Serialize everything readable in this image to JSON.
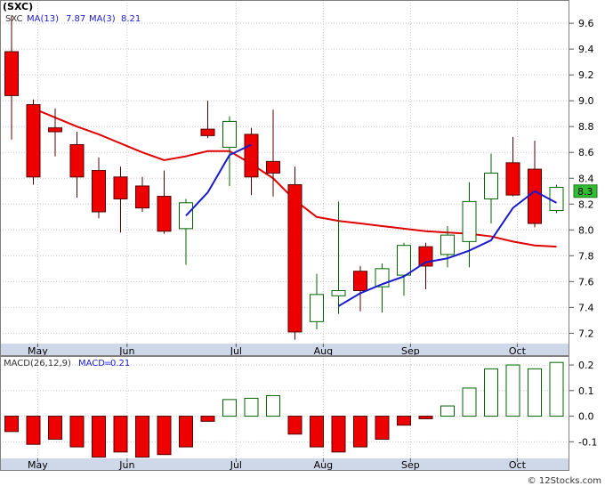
{
  "ticker": "(SXC)",
  "colors": {
    "background": "#ffffff",
    "frame": "#808080",
    "grid": "#c8c8c8",
    "axis_band": "#cfd8e8",
    "up_fill": "#ffffff",
    "up_stroke": "#006400",
    "down_fill": "#ee0000",
    "down_stroke": "#550000",
    "ma13": "#e00000",
    "ma3": "#1a1acc",
    "macd_pos_stroke": "#006400",
    "macd_neg_fill": "#ee0000",
    "last_price_box": "#33bb33"
  },
  "chart_data": [
    {
      "type": "candlestick",
      "symbol": "SXC",
      "legend": {
        "symbol_label": "SXC",
        "ma13_label": "MA(13)",
        "ma13_value": "7.87",
        "ma3_label": "MA(3)",
        "ma3_value": "8.21"
      },
      "ylim": [
        7.12,
        9.78
      ],
      "yticks": [
        7.2,
        7.4,
        7.6,
        7.8,
        8.0,
        8.2,
        8.4,
        8.6,
        8.8,
        9.0,
        9.2,
        9.4,
        9.6
      ],
      "ytick_labels": [
        "7.2",
        "7.4",
        "7.6",
        "7.8",
        "8.0",
        "8.2",
        "8.4",
        "8.6",
        "8.8",
        "9.0",
        "9.2",
        "9.4",
        "9.6"
      ],
      "x_month_labels": [
        {
          "label": "May",
          "index": 1.2
        },
        {
          "label": "Jun",
          "index": 5.3
        },
        {
          "label": "Jul",
          "index": 10.3
        },
        {
          "label": "Aug",
          "index": 14.3
        },
        {
          "label": "Sep",
          "index": 18.3
        },
        {
          "label": "Oct",
          "index": 23.2
        }
      ],
      "last_price_label": "8.3",
      "last_price": 8.3,
      "candles": [
        {
          "o": 9.38,
          "h": 9.66,
          "l": 8.7,
          "c": 9.04
        },
        {
          "o": 8.97,
          "h": 9.01,
          "l": 8.35,
          "c": 8.41
        },
        {
          "o": 8.79,
          "h": 8.94,
          "l": 8.57,
          "c": 8.76
        },
        {
          "o": 8.66,
          "h": 8.76,
          "l": 8.25,
          "c": 8.41
        },
        {
          "o": 8.46,
          "h": 8.56,
          "l": 8.09,
          "c": 8.14
        },
        {
          "o": 8.41,
          "h": 8.49,
          "l": 7.98,
          "c": 8.24
        },
        {
          "o": 8.34,
          "h": 8.41,
          "l": 8.14,
          "c": 8.17
        },
        {
          "o": 8.26,
          "h": 8.46,
          "l": 7.97,
          "c": 7.99
        },
        {
          "o": 8.01,
          "h": 8.24,
          "l": 7.73,
          "c": 8.21
        },
        {
          "o": 8.78,
          "h": 9.0,
          "l": 8.71,
          "c": 8.73
        },
        {
          "o": 8.64,
          "h": 8.88,
          "l": 8.34,
          "c": 8.84
        },
        {
          "o": 8.74,
          "h": 8.79,
          "l": 8.27,
          "c": 8.41
        },
        {
          "o": 8.53,
          "h": 8.93,
          "l": 8.26,
          "c": 8.44
        },
        {
          "o": 8.35,
          "h": 8.49,
          "l": 7.15,
          "c": 7.21
        },
        {
          "o": 7.29,
          "h": 7.66,
          "l": 7.23,
          "c": 7.5
        },
        {
          "o": 7.49,
          "h": 8.22,
          "l": 7.35,
          "c": 7.53
        },
        {
          "o": 7.68,
          "h": 7.72,
          "l": 7.37,
          "c": 7.53
        },
        {
          "o": 7.56,
          "h": 7.74,
          "l": 7.36,
          "c": 7.7
        },
        {
          "o": 7.65,
          "h": 7.9,
          "l": 7.49,
          "c": 7.88
        },
        {
          "o": 7.87,
          "h": 7.9,
          "l": 7.54,
          "c": 7.72
        },
        {
          "o": 7.81,
          "h": 8.03,
          "l": 7.71,
          "c": 7.96
        },
        {
          "o": 7.91,
          "h": 8.37,
          "l": 7.71,
          "c": 8.22
        },
        {
          "o": 8.24,
          "h": 8.59,
          "l": 8.05,
          "c": 8.44
        },
        {
          "o": 8.52,
          "h": 8.72,
          "l": 8.26,
          "c": 8.27
        },
        {
          "o": 8.47,
          "h": 8.69,
          "l": 8.02,
          "c": 8.05
        },
        {
          "o": 8.15,
          "h": 8.35,
          "l": 8.13,
          "c": 8.33
        }
      ],
      "ma13": [
        null,
        8.94,
        8.87,
        8.8,
        8.74,
        8.67,
        8.6,
        8.54,
        8.57,
        8.61,
        8.61,
        8.51,
        8.4,
        8.23,
        8.1,
        8.07,
        8.05,
        8.03,
        8.01,
        7.99,
        7.98,
        7.97,
        7.95,
        7.91,
        7.88,
        7.87
      ],
      "ma3": [
        null,
        null,
        null,
        null,
        null,
        null,
        null,
        null,
        8.11,
        8.29,
        8.58,
        8.66,
        null,
        null,
        null,
        7.41,
        7.51,
        7.58,
        7.64,
        7.75,
        7.78,
        7.84,
        7.92,
        8.17,
        8.3,
        8.21
      ]
    },
    {
      "type": "bar",
      "name": "MACD",
      "legend": {
        "label": "MACD(26,12,9)",
        "value_label": "MACD",
        "value": "0.21"
      },
      "ylim": [
        -0.165,
        0.235
      ],
      "yticks": [
        0.2,
        0.1,
        0.0,
        -0.1
      ],
      "ytick_labels": [
        "0.2",
        "0.1",
        "0.0",
        "-0.1"
      ],
      "values": [
        -0.06,
        -0.11,
        -0.09,
        -0.12,
        -0.16,
        -0.14,
        -0.16,
        -0.15,
        -0.12,
        -0.02,
        0.065,
        0.07,
        0.08,
        -0.07,
        -0.12,
        -0.14,
        -0.12,
        -0.09,
        -0.035,
        -0.01,
        0.04,
        0.11,
        0.185,
        0.2,
        0.185,
        0.21
      ]
    }
  ],
  "x_axis_months": [
    "May",
    "Jun",
    "Jul",
    "Aug",
    "Sep",
    "Oct"
  ],
  "watermark": "© 12Stocks.com"
}
